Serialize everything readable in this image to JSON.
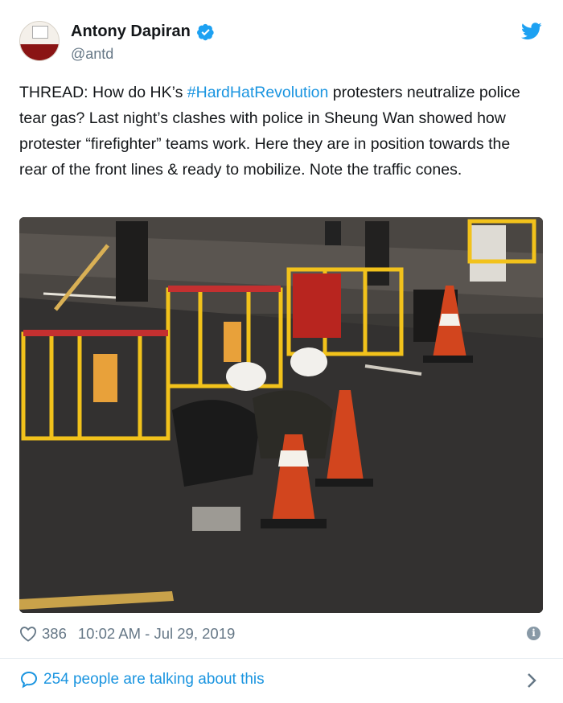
{
  "author": {
    "name": "Antony Dapiran",
    "handle": "@antd",
    "verified": true
  },
  "tweet": {
    "text_before": "THREAD: How do HK’s ",
    "hashtag": "#HardHatRevolution",
    "text_after": " protesters neutralize police tear gas? Last night’s clashes with police in Sheung Wan showed how protester “firefighter” teams work. Here they are in position towards the rear of the front lines & ready to mobilize. Note the traffic cones."
  },
  "meta": {
    "likes": "386",
    "timestamp": "10:02 AM - Jul 29, 2019"
  },
  "footer": {
    "talking_label": "254 people are talking about this"
  },
  "colors": {
    "link": "#1b95e0",
    "muted": "#657786",
    "verified": "#1da1f2",
    "barrier": "#f2c21b",
    "cone": "#d2451e"
  },
  "icons": [
    "verified-badge-icon",
    "twitter-bird-icon",
    "heart-icon",
    "info-icon",
    "speech-bubble-icon",
    "chevron-right-icon"
  ]
}
